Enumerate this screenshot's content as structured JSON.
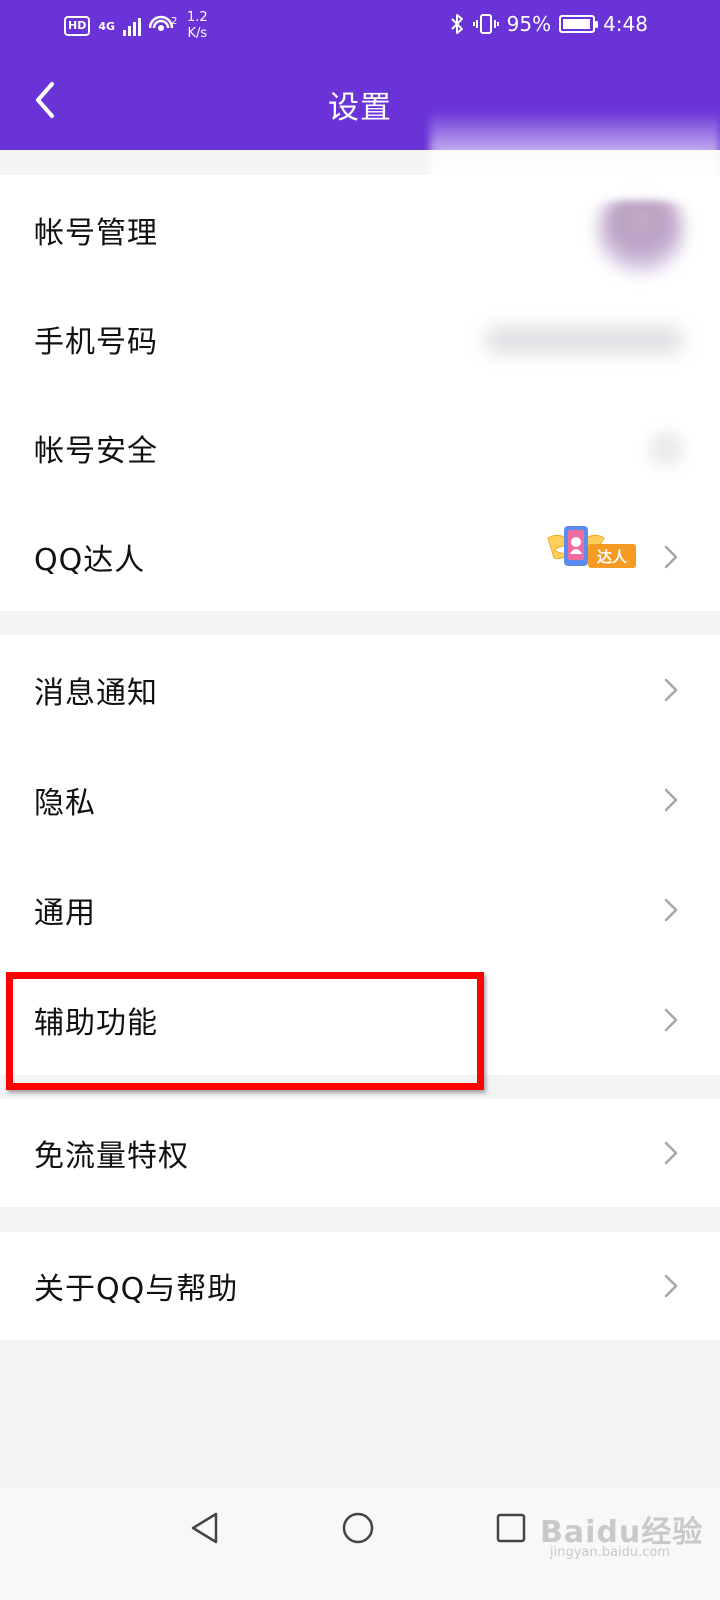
{
  "status_bar": {
    "hd": "HD",
    "network": "4G",
    "hotspot_count": "2",
    "speed_value": "1.2",
    "speed_unit": "K/s",
    "battery": "95%",
    "time": "4:48"
  },
  "header": {
    "title": "设置"
  },
  "groups": [
    {
      "items": [
        {
          "label": "帐号管理"
        },
        {
          "label": "手机号码"
        },
        {
          "label": "帐号安全"
        },
        {
          "label": "QQ达人",
          "badge": "达人"
        }
      ]
    },
    {
      "items": [
        {
          "label": "消息通知"
        },
        {
          "label": "隐私"
        },
        {
          "label": "通用"
        },
        {
          "label": "辅助功能",
          "highlighted": true
        }
      ]
    },
    {
      "items": [
        {
          "label": "免流量特权"
        }
      ]
    },
    {
      "items": [
        {
          "label": "关于QQ与帮助"
        }
      ]
    }
  ],
  "watermark": {
    "main": "Baidu经验",
    "sub": "jingyan.baidu.com"
  },
  "colors": {
    "header": "#6933d8",
    "highlight": "#ff0000",
    "badge": "#f5a623"
  }
}
